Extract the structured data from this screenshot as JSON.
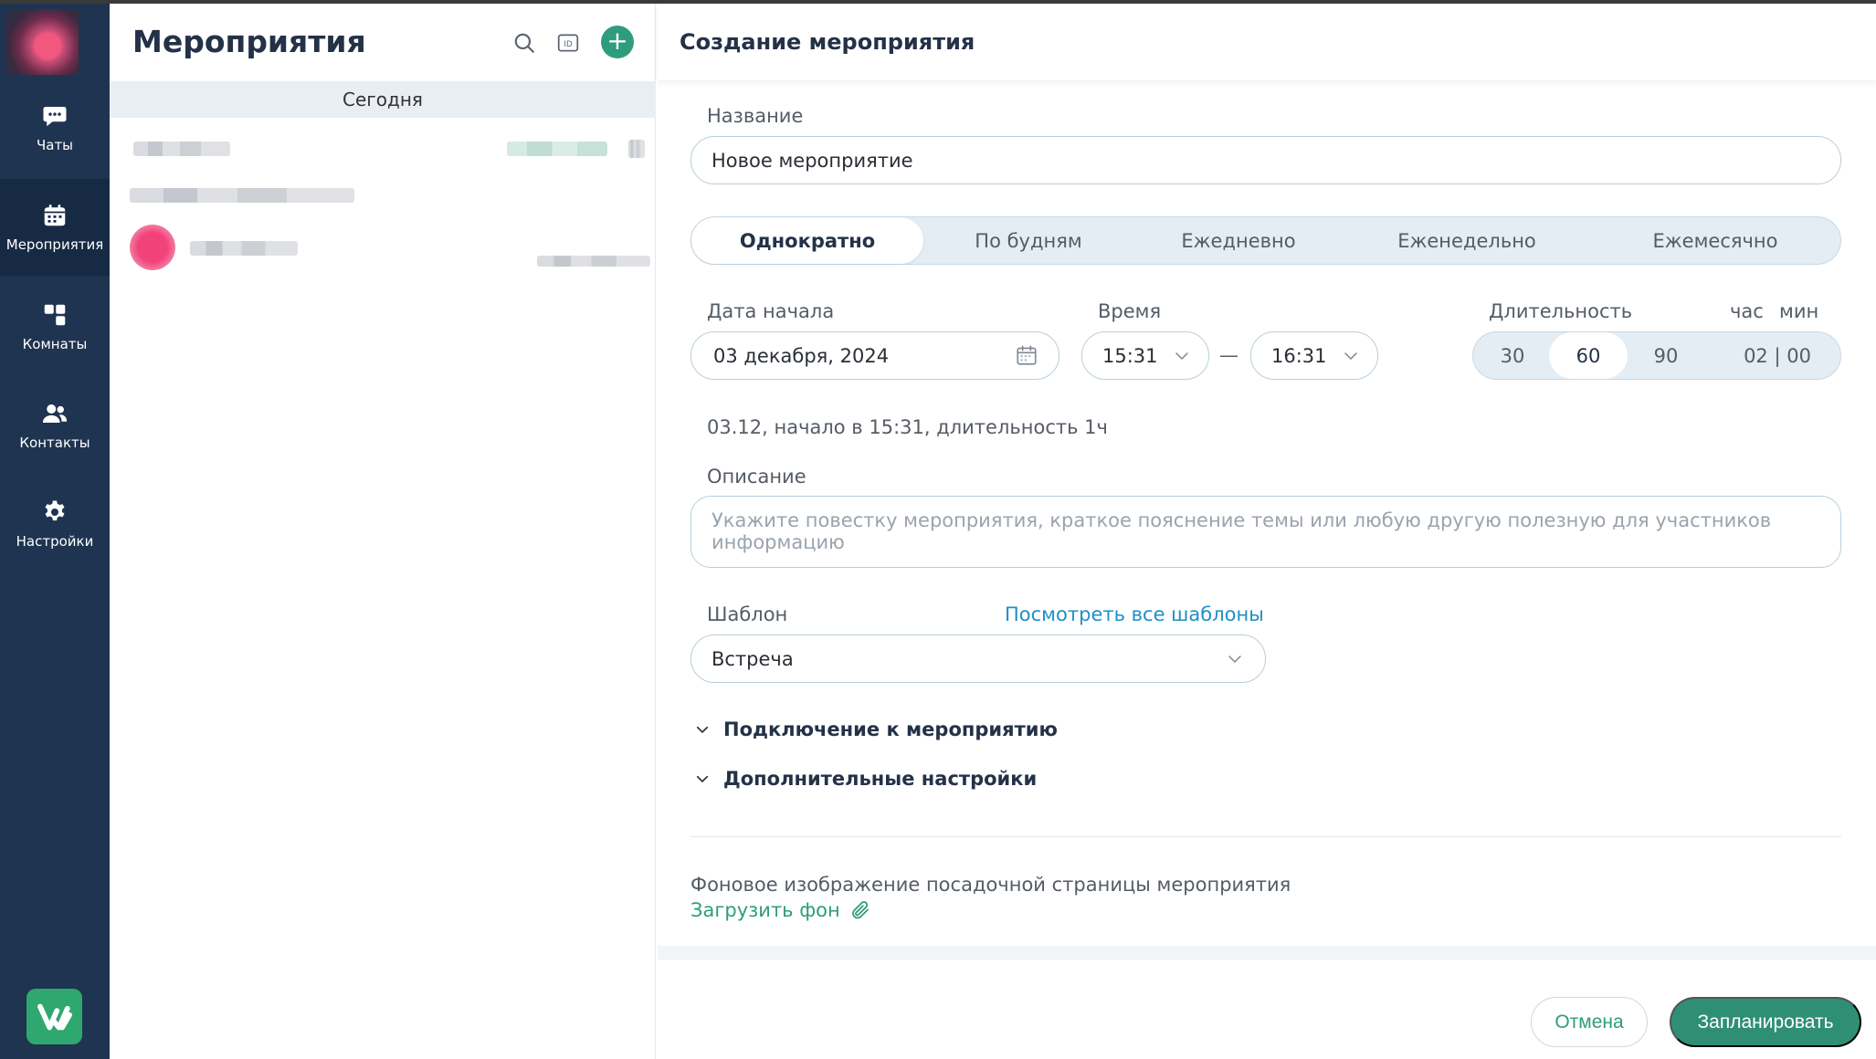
{
  "sidebar": {
    "items": [
      {
        "label": "Чаты",
        "icon": "chat-icon"
      },
      {
        "label": "Мероприятия",
        "icon": "calendar-icon"
      },
      {
        "label": "Комнаты",
        "icon": "rooms-icon"
      },
      {
        "label": "Контакты",
        "icon": "contacts-icon"
      },
      {
        "label": "Настройки",
        "icon": "gear-icon"
      }
    ],
    "active_item": "Мероприятия"
  },
  "list": {
    "title": "Мероприятия",
    "section": "Сегодня",
    "toolbar_icons": [
      "search-icon",
      "id-icon",
      "plus-icon"
    ]
  },
  "form": {
    "title": "Создание мероприятия",
    "name_label": "Название",
    "name_value": "Новое мероприятие",
    "recurrence": [
      "Однократно",
      "По будням",
      "Ежедневно",
      "Еженедельно",
      "Ежемесячно"
    ],
    "recurrence_selected": "Однократно",
    "start_date_label": "Дата начала",
    "start_date_value": "03 декабря, 2024",
    "time_label": "Время",
    "time_from": "15:31",
    "time_dash": "—",
    "time_to": "16:31",
    "duration_label": "Длительность",
    "hour_label": "час",
    "min_label": "мин",
    "duration_options": [
      "30",
      "60",
      "90"
    ],
    "duration_selected": "60",
    "duration_custom": "02 | 00",
    "summary": "03.12, начало в 15:31, длительность 1ч",
    "description_label": "Описание",
    "description_placeholder": "Укажите повестку мероприятия, краткое пояснение темы или любую другую полезную для участников информацию",
    "template_label": "Шаблон",
    "template_link": "Посмотреть все шаблоны",
    "template_value": "Встреча",
    "section_connection": "Подключение к мероприятию",
    "section_advanced": "Дополнительные настройки",
    "background_label": "Фоновое изображение посадочной страницы мероприятия",
    "background_upload": "Загрузить фон"
  },
  "footer": {
    "cancel": "Отмена",
    "submit": "Запланировать"
  },
  "colors": {
    "sidebar": "#1f3450",
    "accent": "#2f9c7d",
    "link": "#1f8fc7"
  }
}
